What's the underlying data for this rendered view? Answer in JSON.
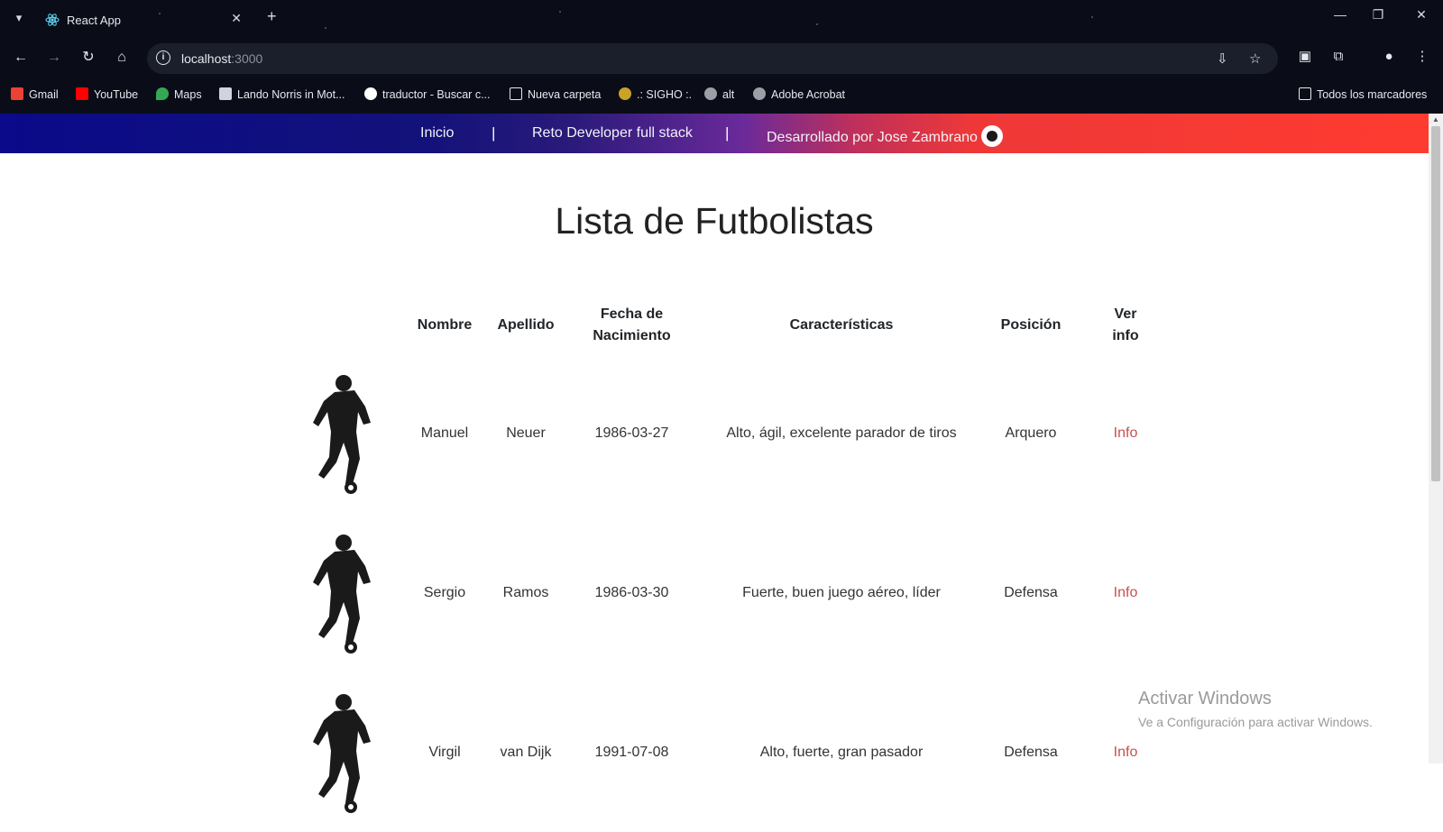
{
  "browser": {
    "tab_title": "React App",
    "url_host": "localhost",
    "url_port": ":3000",
    "bookmarks": [
      {
        "label": "Gmail",
        "color": "#ea4335"
      },
      {
        "label": "YouTube",
        "color": "#ff0000"
      },
      {
        "label": "Maps",
        "color": "#34a853"
      },
      {
        "label": "Lando Norris in Mot...",
        "color": "#d0d4dc"
      },
      {
        "label": "traductor - Buscar c...",
        "color": "#4285f4"
      },
      {
        "label": "Nueva carpeta",
        "color": "#0a0d17"
      },
      {
        "label": ".: SIGHO :.",
        "color": "#c9a227"
      },
      {
        "label": "alt",
        "color": "#9aa0a6"
      },
      {
        "label": "Adobe Acrobat",
        "color": "#9aa0a6"
      }
    ],
    "all_bookmarks": "Todos los marcadores"
  },
  "nav": {
    "inicio": "Inicio",
    "sep": "|",
    "reto": "Reto Developer full stack",
    "dev": "Desarrollado por Jose Zambrano"
  },
  "page": {
    "title": "Lista de Futbolistas"
  },
  "table": {
    "headers": {
      "nombre": "Nombre",
      "apellido": "Apellido",
      "fecha_1": "Fecha de",
      "fecha_2": "Nacimiento",
      "caracteristicas": "Características",
      "posicion": "Posición",
      "ver_1": "Ver",
      "ver_2": "info"
    },
    "rows": [
      {
        "nombre": "Manuel",
        "apellido": "Neuer",
        "fecha": "1986-03-27",
        "caracteristicas": "Alto, ágil, excelente parador de tiros",
        "posicion": "Arquero",
        "info": "Info"
      },
      {
        "nombre": "Sergio",
        "apellido": "Ramos",
        "fecha": "1986-03-30",
        "caracteristicas": "Fuerte, buen juego aéreo, líder",
        "posicion": "Defensa",
        "info": "Info"
      },
      {
        "nombre": "Virgil",
        "apellido": "van Dijk",
        "fecha": "1991-07-08",
        "caracteristicas": "Alto, fuerte, gran pasador",
        "posicion": "Defensa",
        "info": "Info"
      }
    ]
  },
  "watermark": {
    "line1": "Activar Windows",
    "line2": "Ve a Configuración para activar Windows."
  }
}
